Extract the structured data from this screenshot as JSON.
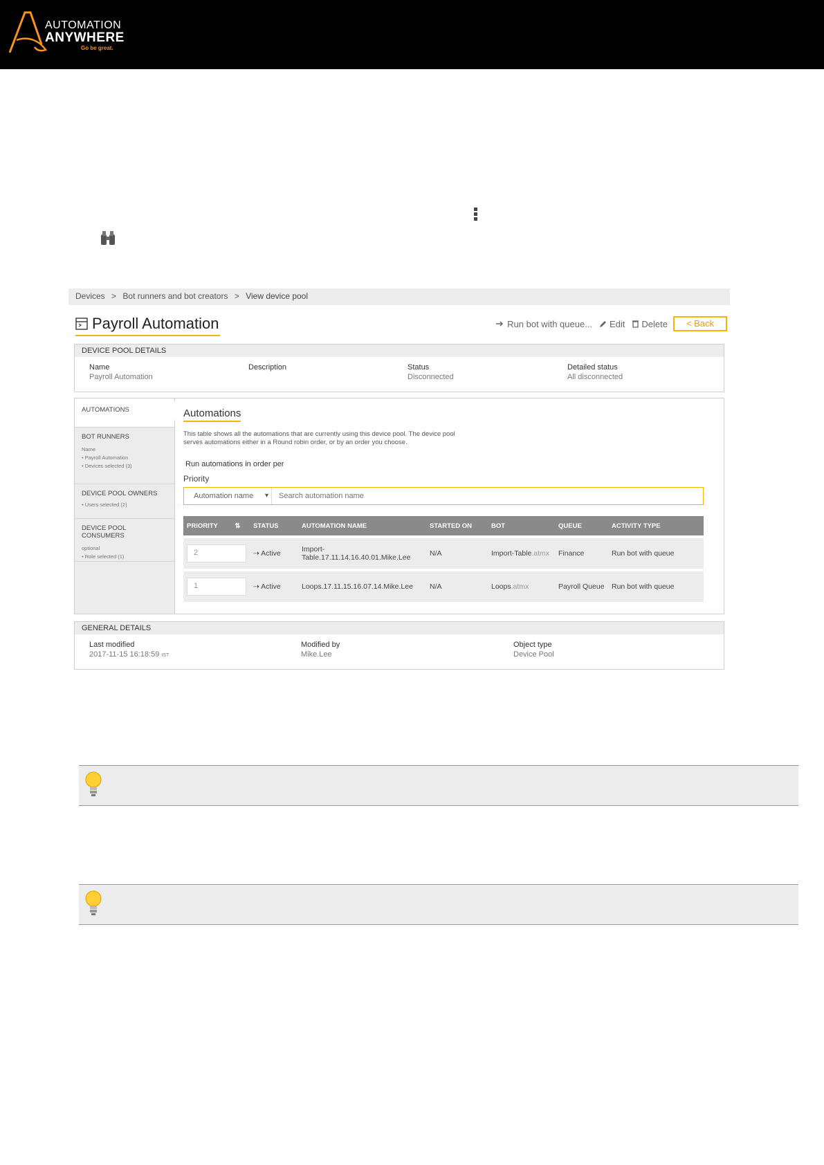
{
  "logo": {
    "line1": "AUTOMATION",
    "line2": "ANYWHERE",
    "tagline": "Go be great."
  },
  "colors": {
    "accent": "#f5b400",
    "brand_orange": "#f7941d",
    "header_bg": "#000000",
    "table_head": "#8a8a8a"
  },
  "breadcrumb": [
    "Devices",
    ">",
    "Bot runners and bot creators",
    ">",
    "View device pool"
  ],
  "page": {
    "title": "Payroll Automation",
    "icon": "device-pool-icon"
  },
  "actions": {
    "run_label": "Run bot with queue...",
    "edit_label": "Edit",
    "delete_label": "Delete",
    "back_label": "< Back"
  },
  "details": {
    "header": "DEVICE POOL DETAILS",
    "name_label": "Name",
    "name_value": "Payroll Automation",
    "description_label": "Description",
    "status_label": "Status",
    "status_value": "Disconnected",
    "detailed_label": "Detailed status",
    "detailed_value": "All disconnected"
  },
  "sidebar": {
    "automations": "AUTOMATIONS",
    "bot_runners": "BOT RUNNERS",
    "bot_runners_sub1": "Name",
    "bot_runners_sub2": "• Payroll Automation",
    "bot_runners_sub3": "• Devices selected (3)",
    "owners": "DEVICE POOL OWNERS",
    "owners_sub": "• Users selected (2)",
    "consumers": "DEVICE POOL CONSUMERS",
    "consumers_sub1": "optional",
    "consumers_sub2": "• Role selected (1)"
  },
  "main": {
    "title": "Automations",
    "description": "This table shows all the automations that are currently using this device pool. The device pool serves automations either in a Round robin order, or by an order you choose.",
    "order_label": "Run automations in order per",
    "order_value": "Priority",
    "search_select": "Automation name",
    "search_placeholder": "Search automation name"
  },
  "table": {
    "columns": [
      "PRIORITY",
      "STATUS",
      "AUTOMATION NAME",
      "STARTED ON",
      "BOT",
      "QUEUE",
      "ACTIVITY TYPE"
    ],
    "rows": [
      {
        "priority": "2",
        "status": "Active",
        "name": "Import-Table.17.11.14.16.40.01.Mike.Lee",
        "started": "N/A",
        "bot": "Import-Table",
        "bot_ext": ".atmx",
        "queue": "Finance",
        "activity": "Run bot with queue"
      },
      {
        "priority": "1",
        "status": "Active",
        "name": "Loops.17.11.15.16.07.14.Mike.Lee",
        "started": "N/A",
        "bot": "Loops",
        "bot_ext": ".atmx",
        "queue": "Payroll Queue",
        "activity": "Run bot with queue"
      }
    ]
  },
  "general": {
    "header": "GENERAL DETAILS",
    "modified_label": "Last modified",
    "modified_value": "2017-11-15 16:18:59",
    "modified_tz": "IST",
    "by_label": "Modified by",
    "by_value": "Mike.Lee",
    "type_label": "Object type",
    "type_value": "Device Pool"
  },
  "notes": [
    {
      "icon": "lightbulb-icon"
    },
    {
      "icon": "lightbulb-icon"
    }
  ]
}
